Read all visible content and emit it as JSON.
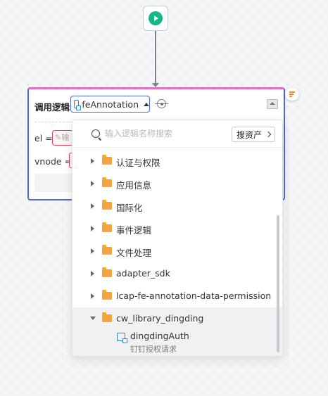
{
  "start_node": {
    "icon": "play-icon"
  },
  "logic_node": {
    "label": "调用逻辑",
    "selected_logic": "feAnnotation",
    "params": [
      {
        "name": "el =",
        "placeholder": "输"
      },
      {
        "name": "vnode ="
      }
    ]
  },
  "dropdown": {
    "search_placeholder": "输入逻辑名称搜索",
    "asset_button": "搜资产",
    "tree": [
      {
        "label": "认证与权限",
        "expanded": false
      },
      {
        "label": "应用信息",
        "expanded": false
      },
      {
        "label": "国际化",
        "expanded": false
      },
      {
        "label": "事件逻辑",
        "expanded": false
      },
      {
        "label": "文件处理",
        "expanded": false
      },
      {
        "label": "adapter_sdk",
        "expanded": false
      },
      {
        "label": "lcap-fe-annotation-data-permission",
        "expanded": false
      },
      {
        "label": "cw_library_dingding",
        "expanded": true
      }
    ],
    "selected_leaf": {
      "title": "dingdingAuth",
      "description": "钉钉授权请求"
    }
  },
  "colors": {
    "node_border": "#4a67e0",
    "node_top_accent": "#e76bc8",
    "start_play": "#12b886",
    "folder": "#f5a43b",
    "error_border": "#e0455a"
  }
}
